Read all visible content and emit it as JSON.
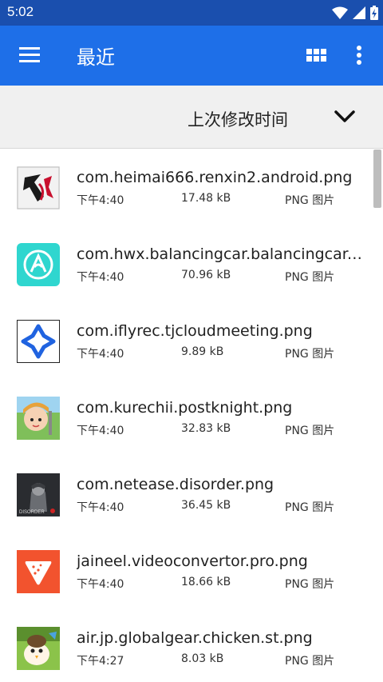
{
  "status_bar": {
    "time": "5:02"
  },
  "app_bar": {
    "title": "最近"
  },
  "sort_bar": {
    "label": "上次修改时间"
  },
  "files": [
    {
      "name": "com.heimai666.renxin2.android.png",
      "time": "下午4:40",
      "size": "17.48 kB",
      "type": "PNG 图片"
    },
    {
      "name": "com.hwx.balancingcar.balancingcar.png",
      "time": "下午4:40",
      "size": "70.96 kB",
      "type": "PNG 图片"
    },
    {
      "name": "com.iflyrec.tjcloudmeeting.png",
      "time": "下午4:40",
      "size": "9.89 kB",
      "type": "PNG 图片"
    },
    {
      "name": "com.kurechii.postknight.png",
      "time": "下午4:40",
      "size": "32.83 kB",
      "type": "PNG 图片"
    },
    {
      "name": "com.netease.disorder.png",
      "time": "下午4:40",
      "size": "36.45 kB",
      "type": "PNG 图片"
    },
    {
      "name": "jaineel.videoconvertor.pro.png",
      "time": "下午4:40",
      "size": "18.66 kB",
      "type": "PNG 图片"
    },
    {
      "name": "air.jp.globalgear.chicken.st.png",
      "time": "下午4:27",
      "size": "8.03 kB",
      "type": "PNG 图片"
    }
  ],
  "thumb_logos": {
    "disorder": "DISORDER"
  },
  "colors": {
    "status_bar": "#1a4fae",
    "app_bar": "#1e6fe8",
    "sort_bar": "#f0f0f0"
  }
}
